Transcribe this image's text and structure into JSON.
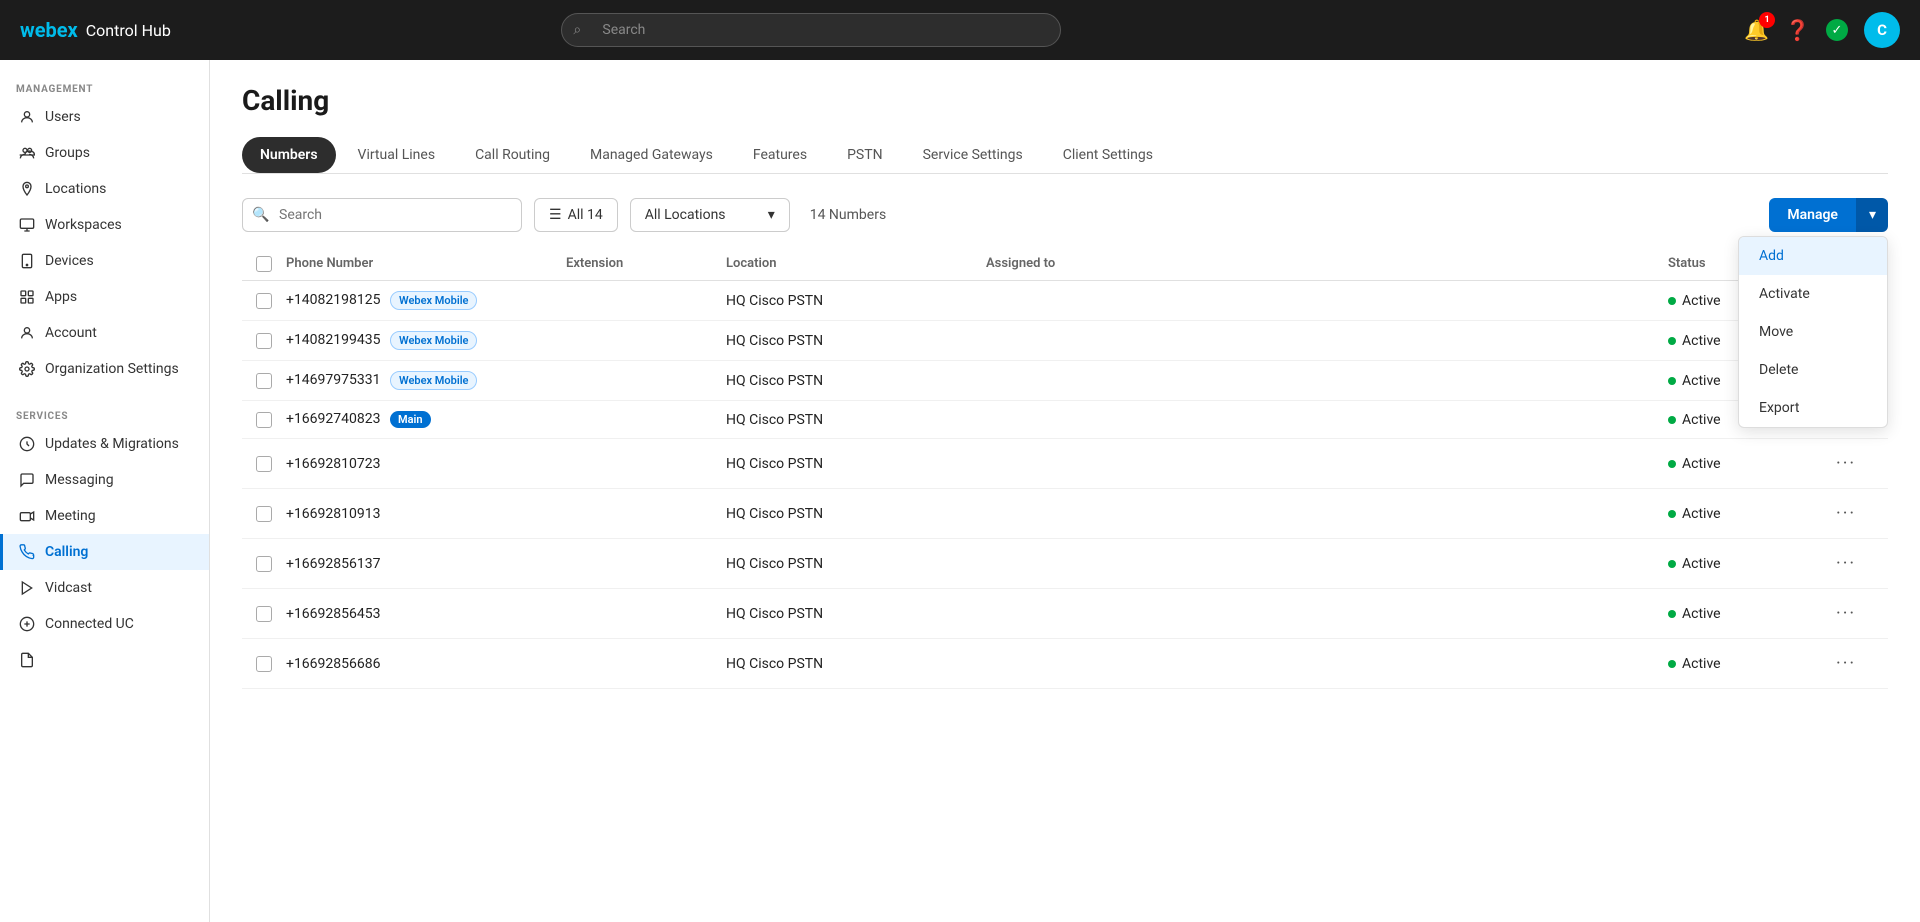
{
  "app": {
    "logo_webex": "webex",
    "logo_control_hub": "Control Hub",
    "search_placeholder": "Search",
    "user_avatar_initials": "C"
  },
  "notifications": {
    "bell_count": "1"
  },
  "sidebar": {
    "management_label": "MANAGEMENT",
    "services_label": "SERVICES",
    "management_items": [
      {
        "id": "users",
        "label": "Users"
      },
      {
        "id": "groups",
        "label": "Groups"
      },
      {
        "id": "locations",
        "label": "Locations"
      },
      {
        "id": "workspaces",
        "label": "Workspaces"
      },
      {
        "id": "devices",
        "label": "Devices"
      },
      {
        "id": "apps",
        "label": "Apps"
      },
      {
        "id": "account",
        "label": "Account"
      },
      {
        "id": "org-settings",
        "label": "Organization Settings"
      }
    ],
    "services_items": [
      {
        "id": "updates",
        "label": "Updates & Migrations"
      },
      {
        "id": "messaging",
        "label": "Messaging"
      },
      {
        "id": "meeting",
        "label": "Meeting"
      },
      {
        "id": "calling",
        "label": "Calling",
        "active": true
      },
      {
        "id": "vidcast",
        "label": "Vidcast"
      },
      {
        "id": "connected-uc",
        "label": "Connected UC"
      }
    ]
  },
  "page": {
    "title": "Calling"
  },
  "tabs": [
    {
      "id": "numbers",
      "label": "Numbers",
      "active": true
    },
    {
      "id": "virtual-lines",
      "label": "Virtual Lines"
    },
    {
      "id": "call-routing",
      "label": "Call Routing"
    },
    {
      "id": "managed-gateways",
      "label": "Managed Gateways"
    },
    {
      "id": "features",
      "label": "Features"
    },
    {
      "id": "pstn",
      "label": "PSTN"
    },
    {
      "id": "service-settings",
      "label": "Service Settings"
    },
    {
      "id": "client-settings",
      "label": "Client Settings"
    }
  ],
  "toolbar": {
    "search_placeholder": "Search",
    "filter_label": "All 14",
    "location_label": "All Locations",
    "count_label": "14 Numbers",
    "manage_label": "Manage"
  },
  "columns": {
    "phone_number": "Phone Number",
    "extension": "Extension",
    "location": "Location",
    "assigned_to": "Assigned to",
    "status": "Status"
  },
  "table_rows": [
    {
      "phone": "+14082198125",
      "tag": "Webex Mobile",
      "tag_type": "webex",
      "location": "HQ Cisco PSTN",
      "status": "Active"
    },
    {
      "phone": "+14082199435",
      "tag": "Webex Mobile",
      "tag_type": "webex",
      "location": "HQ Cisco PSTN",
      "status": "Active"
    },
    {
      "phone": "+14697975331",
      "tag": "Webex Mobile",
      "tag_type": "webex",
      "location": "HQ Cisco PSTN",
      "status": "Active"
    },
    {
      "phone": "+16692740823",
      "tag": "Main",
      "tag_type": "main",
      "location": "HQ Cisco PSTN",
      "status": "Active"
    },
    {
      "phone": "+16692810723",
      "tag": null,
      "location": "HQ Cisco PSTN",
      "status": "Active"
    },
    {
      "phone": "+16692810913",
      "tag": null,
      "location": "HQ Cisco PSTN",
      "status": "Active"
    },
    {
      "phone": "+16692856137",
      "tag": null,
      "location": "HQ Cisco PSTN",
      "status": "Active"
    },
    {
      "phone": "+16692856453",
      "tag": null,
      "location": "HQ Cisco PSTN",
      "status": "Active"
    },
    {
      "phone": "+16692856686",
      "tag": null,
      "location": "HQ Cisco PSTN",
      "status": "Active"
    }
  ],
  "dropdown": {
    "items": [
      {
        "id": "add",
        "label": "Add",
        "active": true
      },
      {
        "id": "activate",
        "label": "Activate"
      },
      {
        "id": "move",
        "label": "Move"
      },
      {
        "id": "delete",
        "label": "Delete"
      },
      {
        "id": "export",
        "label": "Export"
      }
    ]
  }
}
